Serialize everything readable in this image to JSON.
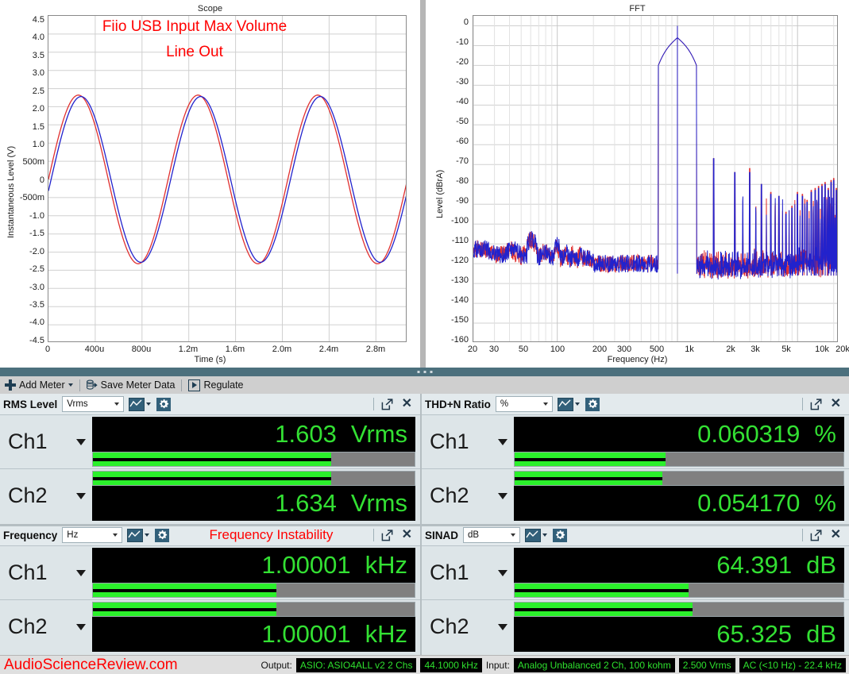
{
  "charts": {
    "scope": {
      "title": "Scope",
      "annotation_line1": "Fiio USB Input Max Volume",
      "annotation_line2": "Line Out"
    },
    "fft": {
      "title": "FFT"
    }
  },
  "toolbar": {
    "add_meter": "Add Meter",
    "save_meter_data": "Save Meter Data",
    "regulate": "Regulate"
  },
  "meters": [
    {
      "title": "RMS Level",
      "unit_select": "Vrms",
      "annotation": "",
      "ch1": {
        "label": "Ch1",
        "value": "1.603",
        "unit": "Vrms",
        "bar_pct": 74
      },
      "ch2": {
        "label": "Ch2",
        "value": "1.634",
        "unit": "Vrms",
        "bar_pct": 74
      }
    },
    {
      "title": "THD+N Ratio",
      "unit_select": "%",
      "annotation": "",
      "ch1": {
        "label": "Ch1",
        "value": "0.060319",
        "unit": "%",
        "bar_pct": 46
      },
      "ch2": {
        "label": "Ch2",
        "value": "0.054170",
        "unit": "%",
        "bar_pct": 45
      }
    },
    {
      "title": "Frequency",
      "unit_select": "Hz",
      "annotation": "Frequency Instability",
      "ch1": {
        "label": "Ch1",
        "value": "1.00001",
        "unit": "kHz",
        "bar_pct": 57
      },
      "ch2": {
        "label": "Ch2",
        "value": "1.00001",
        "unit": "kHz",
        "bar_pct": 57
      }
    },
    {
      "title": "SINAD",
      "unit_select": "dB",
      "annotation": "",
      "ch1": {
        "label": "Ch1",
        "value": "64.391",
        "unit": "dB",
        "bar_pct": 53
      },
      "ch2": {
        "label": "Ch2",
        "value": "65.325",
        "unit": "dB",
        "bar_pct": 54
      }
    }
  ],
  "status": {
    "brand": "AudioScienceReview.com",
    "output_label": "Output:",
    "output_device": "ASIO: ASIO4ALL v2 2 Chs",
    "sample_rate": "44.1000 kHz",
    "input_label": "Input:",
    "input_device": "Analog Unbalanced 2 Ch, 100 kohm",
    "input_range": "2.500 Vrms",
    "input_filter": "AC (<10 Hz) - 22.4 kHz"
  },
  "colors": {
    "ch1_trace": "#2222cc",
    "ch2_trace": "#e03030",
    "meter_green": "#33e033",
    "accent_red": "#ff0000",
    "splitter": "#4c707d"
  },
  "chart_data": [
    {
      "type": "line",
      "name": "scope",
      "title": "Scope",
      "xlabel": "Time (s)",
      "ylabel": "Instantaneous Level (V)",
      "xlim": [
        0,
        0.003
      ],
      "ylim": [
        -4.5,
        4.5
      ],
      "grid": true,
      "xticks": [
        "0",
        "400u",
        "800u",
        "1.2m",
        "1.6m",
        "2.0m",
        "2.4m",
        "2.8m"
      ],
      "xtick_values": [
        0,
        0.0004,
        0.0008,
        0.0012,
        0.0016,
        0.002,
        0.0024,
        0.0028
      ],
      "yticks": [
        "4.5",
        "4.0",
        "3.5",
        "3.0",
        "2.5",
        "2.0",
        "1.5",
        "1.0",
        "500m",
        "0",
        "-500m",
        "-1.0",
        "-1.5",
        "-2.0",
        "-2.5",
        "-3.0",
        "-3.5",
        "-4.0",
        "-4.5"
      ],
      "ytick_values": [
        4.5,
        4.0,
        3.5,
        3.0,
        2.5,
        2.0,
        1.5,
        1.0,
        0.5,
        0,
        -0.5,
        -1.0,
        -1.5,
        -2.0,
        -2.5,
        -3.0,
        -3.5,
        -4.0,
        -4.5
      ],
      "annotations": [
        "Fiio USB Input Max Volume",
        "Line Out"
      ],
      "series": [
        {
          "name": "Ch1",
          "color": "#2222cc",
          "waveform": "sine",
          "amplitude": 2.28,
          "frequency_hz": 1000,
          "phase_deg": -8
        },
        {
          "name": "Ch2",
          "color": "#e03030",
          "waveform": "sine",
          "amplitude": 2.32,
          "frequency_hz": 1000,
          "phase_deg": 0
        }
      ]
    },
    {
      "type": "line",
      "name": "fft",
      "title": "FFT",
      "xlabel": "Frequency (Hz)",
      "ylabel": "Level (dBrA)",
      "xscale": "log",
      "xlim": [
        20,
        22000
      ],
      "ylim": [
        -160,
        5
      ],
      "grid": true,
      "xticks": [
        "20",
        "30",
        "50",
        "100",
        "200",
        "300",
        "500",
        "1k",
        "2k",
        "3k",
        "5k",
        "10k",
        "20k"
      ],
      "xtick_values": [
        20,
        30,
        50,
        100,
        200,
        300,
        500,
        1000,
        2000,
        3000,
        5000,
        10000,
        20000
      ],
      "yticks": [
        "0",
        "-10",
        "-20",
        "-30",
        "-40",
        "-50",
        "-60",
        "-70",
        "-80",
        "-90",
        "-100",
        "-110",
        "-120",
        "-130",
        "-140",
        "-150",
        "-160"
      ],
      "ytick_values": [
        0,
        -10,
        -20,
        -30,
        -40,
        -50,
        -60,
        -70,
        -80,
        -90,
        -100,
        -110,
        -120,
        -130,
        -140,
        -150,
        -160
      ],
      "noise_floor_db": -122,
      "series": [
        {
          "name": "Ch1",
          "color": "#2222cc",
          "peaks_hz": [
            1000,
            2000,
            3000,
            4000,
            5000,
            6000,
            7000,
            8000,
            9000,
            10000,
            11000,
            12000,
            13000,
            14000,
            15000,
            16000,
            17000,
            18000,
            19000,
            20000,
            21000
          ],
          "peaks_dbrA": [
            0,
            -67,
            -74,
            -74,
            -80,
            -85,
            -86,
            -95,
            -92,
            -85,
            -86,
            -89,
            -84,
            -83,
            -82,
            -81,
            -80,
            -83,
            -79,
            -78,
            -83
          ]
        },
        {
          "name": "Ch2",
          "color": "#e03030",
          "peaks_hz": [
            1000,
            2000,
            3000,
            4000,
            5000,
            6000,
            7000,
            8000,
            9000,
            10000,
            11000,
            12000,
            13000,
            14000,
            15000,
            16000,
            17000,
            18000,
            19000,
            20000,
            21000
          ],
          "peaks_dbrA": [
            0,
            -67,
            -74,
            -72,
            -80,
            -84,
            -86,
            -94,
            -91,
            -84,
            -85,
            -88,
            -83,
            -82,
            -81,
            -80,
            -79,
            -82,
            -78,
            -77,
            -82
          ]
        }
      ]
    }
  ]
}
